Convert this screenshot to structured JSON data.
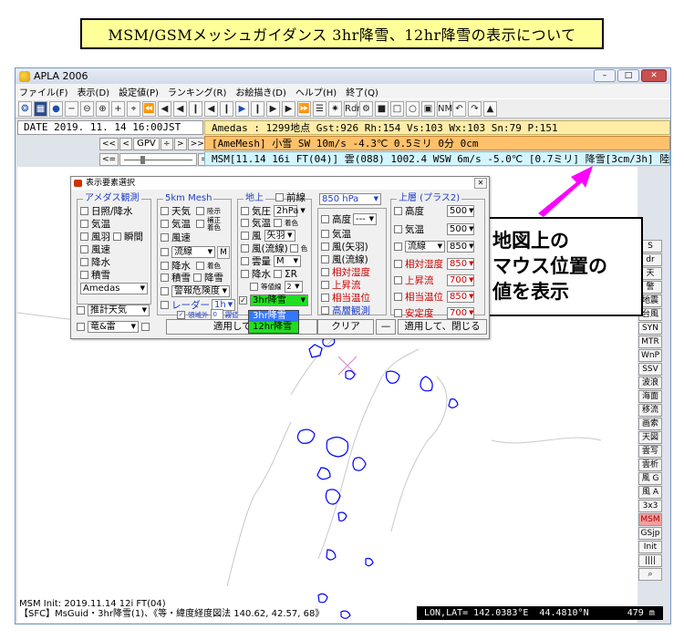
{
  "banner": "MSM/GSMメッシュガイダンス  3hr降雪、12hr降雪の表示について",
  "window": {
    "title": "APLA 2006",
    "buttons": {
      "min": "–",
      "max": "□",
      "close": "✕"
    }
  },
  "menu": [
    "ファイル(F)",
    "表示(D)",
    "設定値(P)",
    "ランキング(R)",
    "お絵描き(D)",
    "ヘルプ(H)",
    "終了(Q)"
  ],
  "toolbar": {
    "items": [
      "❂",
      "▦",
      "●",
      "−",
      "⊖",
      "⊕",
      "+",
      "⌖",
      "⏪",
      "◀",
      "◀",
      "❙",
      "◀",
      "❙",
      "▶",
      "❙",
      "▶",
      "▶",
      "⏩",
      "☰",
      "✷",
      "Rdr",
      "⚙",
      "■",
      "□",
      "○",
      "▣",
      "NM",
      "↶",
      "↷",
      "▲"
    ]
  },
  "date": "DATE 2019. 11. 14  16:00JST",
  "controls": {
    "prev2": "<<",
    "prev": "<",
    "model": "GPV",
    "spin": "÷",
    "next": ">",
    "next2": ">>",
    "left_arrow": "<=",
    "right_arrow": "=>"
  },
  "info": {
    "amedas": "Amedas : 1299地点  Gst:926 Rh:154 Vs:103 Wx:103 Sn:79 P:151",
    "amemesh": "[AmeMesh] 小雪  SW  10m/s -4.3℃  0.5ミリ  0分  0cm",
    "msm": "MSM[11.14 16i FT(04)] 雲(088) 1002.4 WSW 6m/s -5.0℃ [0.7ミリ] 降雪[3cm/3h] 陸 250"
  },
  "sidebar": [
    "S",
    "dr",
    "天",
    "警",
    "地震",
    "台風",
    "SYN",
    "MTR",
    "WnP",
    "SSV",
    "波浪",
    "海面",
    "移流",
    "画索",
    "天図",
    "雲写",
    "雲析",
    "風 G",
    "風 A",
    "3x3",
    "MSM",
    "GSjp",
    "Init",
    "||||",
    "⌕"
  ],
  "sidebar_active": "MSM",
  "status": {
    "line1": "MSM Init: 2019.11.14 12i FT(04)",
    "line2": "【SFC】MsGuid・3hr降雪(1)、《等・緯度経度図法 140.62, 42.57, 68》",
    "lonlat": "LON,LAT= 142.0383°E  44.4810°N       479 m"
  },
  "callout": [
    "地図上の",
    " マウス位置の",
    " 値を表示"
  ],
  "colors": {
    "callout_arrow": "#ff00ff",
    "map_lines": "#0000ff",
    "banner_bg": "#ffff99"
  },
  "dialog": {
    "title": "表示要素選択",
    "groups": {
      "amedas": "アメダス観測",
      "mesh5km": "5km Mesh",
      "surface": "地上",
      "upper": "上層 (プラス2)"
    },
    "amedas_items": [
      "日照/降水",
      "気温",
      "風羽",
      "瞬間",
      "風速",
      "降水",
      "積雪"
    ],
    "amedas_combo": "Amedas",
    "estimate": "推計天気",
    "thunder": "竜&雷",
    "mesh_items": [
      "天気",
      "陸示",
      "気温",
      "補正",
      "着色",
      "風速",
      "流線",
      "M",
      "降水",
      "着色",
      "積雪",
      "降雪",
      "警報危険度",
      "レーダー",
      "1h",
      "領域外",
      "0",
      "霧値"
    ],
    "surface": {
      "front": "前線",
      "items": [
        "気圧",
        "2hPa",
        "気温",
        "着色",
        "風",
        "矢羽",
        "風(流線)",
        "色",
        "雲量",
        "M",
        "降水",
        "ΣR",
        "等値線",
        "2"
      ],
      "snow_combo": "3hr降雪"
    },
    "pressure850": {
      "combo": "850 hPa",
      "items": [
        "高度",
        "---",
        "気温",
        "風(矢羽)",
        "風(流線)",
        "相対湿度",
        "上昇流",
        "相当温位",
        "高層観測"
      ]
    },
    "upper": {
      "items": [
        "高度",
        "500",
        "気温",
        "500",
        "流線",
        "850",
        "相対湿度",
        "850",
        "上昇流",
        "700",
        "相当温位",
        "850",
        "安定度",
        "700"
      ]
    },
    "buttons": {
      "apply_reset": "適用して、再",
      "clear": "クリア",
      "minus": "—",
      "apply_close": "適用して、閉じる"
    },
    "dropdown": [
      "3hr降雪",
      "12hr降雪"
    ]
  }
}
